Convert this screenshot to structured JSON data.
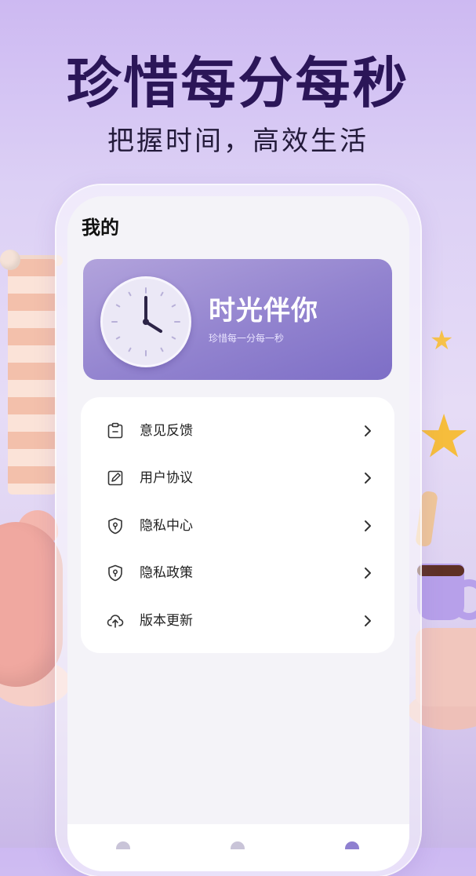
{
  "promo": {
    "headline": "珍惜每分每秒",
    "subheadline": "把握时间，高效生活"
  },
  "screen": {
    "title": "我的",
    "banner": {
      "title": "时光伴你",
      "subtitle": "珍惜每一分每一秒",
      "icon": "clock-icon"
    },
    "menu": [
      {
        "label": "意见反馈",
        "icon": "feedback-icon"
      },
      {
        "label": "用户协议",
        "icon": "edit-document-icon"
      },
      {
        "label": "隐私中心",
        "icon": "shield-icon"
      },
      {
        "label": "隐私政策",
        "icon": "shield-icon"
      },
      {
        "label": "版本更新",
        "icon": "cloud-upload-icon"
      }
    ],
    "tabs": [
      {
        "icon": "tab-home-icon"
      },
      {
        "icon": "tab-stats-icon"
      },
      {
        "icon": "tab-profile-icon",
        "active": true
      }
    ]
  },
  "colors": {
    "headline": "#2b1658",
    "banner_gradient_start": "#b2a3dc",
    "banner_gradient_end": "#7d6ec6",
    "accent_star": "#f6bd3c"
  }
}
